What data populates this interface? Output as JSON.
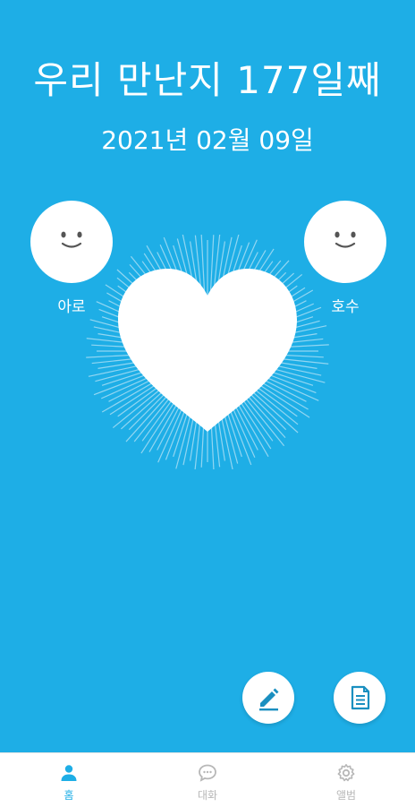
{
  "header": {
    "title": "우리 만난지 177일째",
    "date": "2021년 02월 09일"
  },
  "couple": {
    "left_name": "아로",
    "right_name": "호수"
  },
  "actions": {
    "edit_icon": "pencil-icon",
    "note_icon": "document-icon"
  },
  "bottom_nav": {
    "items": [
      {
        "label": "홈",
        "icon": "person-icon",
        "active": true
      },
      {
        "label": "대화",
        "icon": "chat-icon",
        "active": false
      },
      {
        "label": "앨범",
        "icon": "gear-icon",
        "active": false
      }
    ]
  },
  "colors": {
    "accent": "#1eaee6",
    "inactive": "#b7b7b7",
    "white": "#ffffff"
  }
}
